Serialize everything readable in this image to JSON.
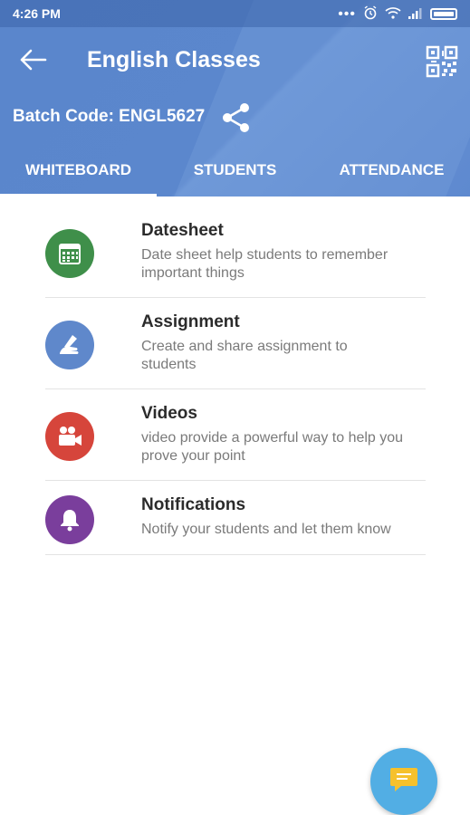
{
  "status_bar": {
    "time": "4:26 PM"
  },
  "toolbar": {
    "title": "English Classes",
    "back_icon": "arrow-left-icon",
    "qr_icon": "qr-code-icon"
  },
  "batch": {
    "label": "Batch Code: ENGL5627",
    "share_icon": "share-icon"
  },
  "tabs": [
    {
      "label": "WHITEBOARD",
      "selected": true
    },
    {
      "label": "STUDENTS",
      "selected": false
    },
    {
      "label": "ATTENDANCE",
      "selected": false
    }
  ],
  "items": [
    {
      "title": "Datesheet",
      "desc_line1": "Date sheet help students to remember",
      "desc_line2": "important things",
      "icon": "calendar-icon",
      "color": "#3f8f4a"
    },
    {
      "title": "Assignment",
      "desc_line1": "Create and share assignment to",
      "desc_line2": "students",
      "icon": "hand-writing-icon",
      "color": "#5f88cb"
    },
    {
      "title": "Videos",
      "desc_line1": "video provide a powerful way to help you",
      "desc_line2": "prove your point",
      "icon": "video-camera-icon",
      "color": "#d6453b"
    },
    {
      "title": "Notifications",
      "desc_line1": "Notify your students and let them know",
      "desc_line2": "",
      "icon": "bell-icon",
      "color": "#7a3e9c"
    }
  ],
  "fab": {
    "icon": "chat-icon",
    "color": "#52aee4"
  },
  "colors": {
    "header": "#5b87cd",
    "accent": "#52aee4"
  }
}
